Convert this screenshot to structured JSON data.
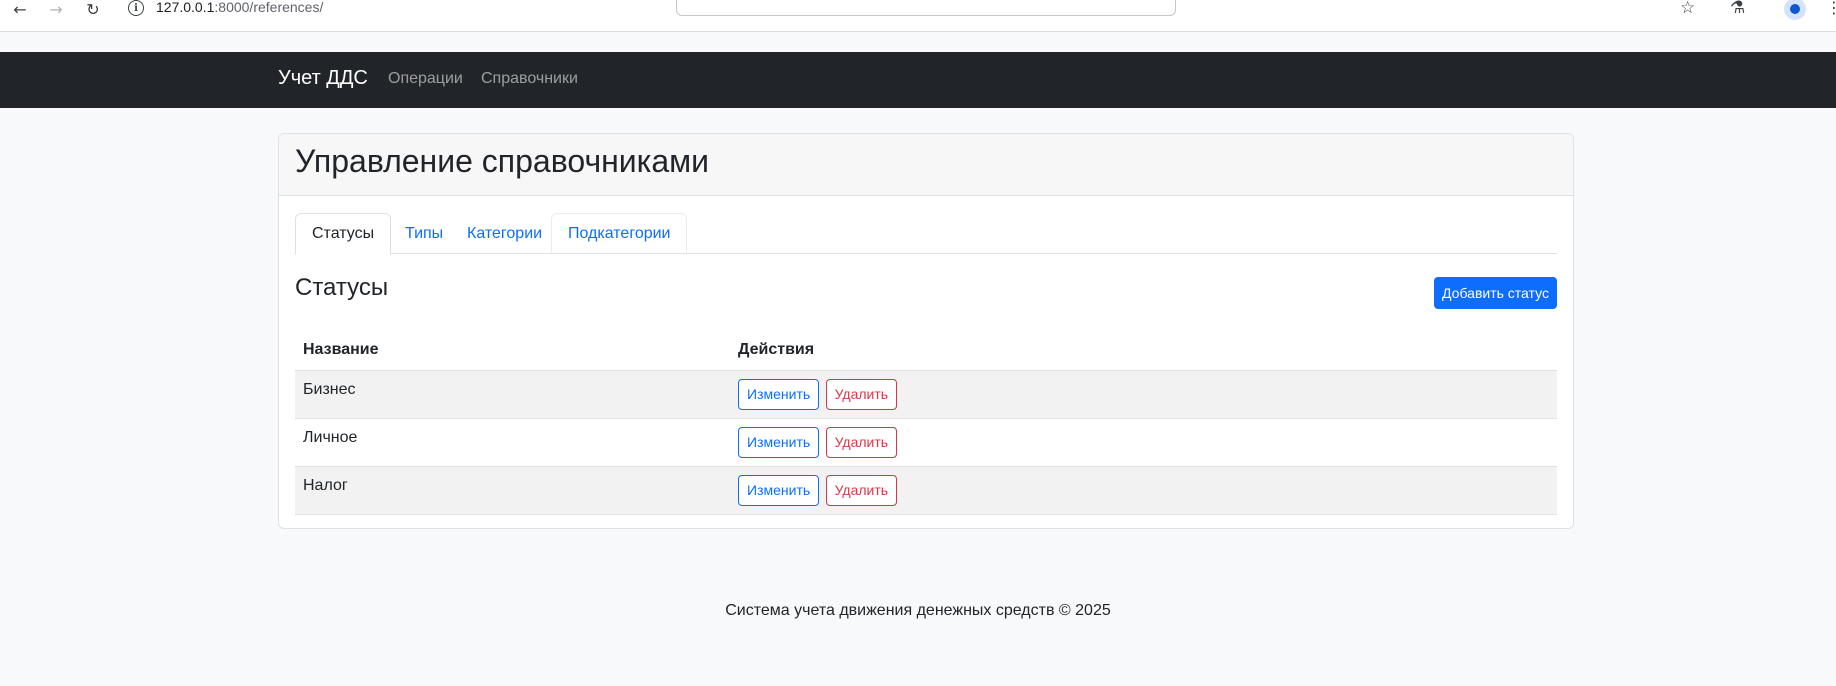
{
  "browser": {
    "url_host": "127.0.0.1",
    "url_rest": ":8000/references/",
    "back_icon": "←",
    "forward_icon": "→",
    "reload_icon": "↻",
    "info_icon": "i",
    "star_icon": "☆",
    "labs_icon": "⚗",
    "menu_icon": "⋮"
  },
  "navbar": {
    "brand": "Учет ДДС",
    "links": [
      "Операции",
      "Справочники"
    ]
  },
  "card": {
    "title": "Управление справочниками",
    "tabs": [
      "Статусы",
      "Типы",
      "Категории",
      "Подкатегории"
    ],
    "active_tab": "Статусы"
  },
  "section": {
    "title": "Статусы",
    "add_button": "Добавить статус"
  },
  "table": {
    "columns": [
      "Название",
      "Действия"
    ],
    "rows": [
      {
        "name": "Бизнес",
        "edit": "Изменить",
        "delete": "Удалить"
      },
      {
        "name": "Личное",
        "edit": "Изменить",
        "delete": "Удалить"
      },
      {
        "name": "Налог",
        "edit": "Изменить",
        "delete": "Удалить"
      }
    ]
  },
  "footer": {
    "text": "Система учета движения денежных средств © 2025"
  },
  "colors": {
    "navbar_bg": "#212529",
    "primary": "#0d6efd",
    "danger": "#dc3545",
    "page_bg": "#f8f9fa"
  }
}
